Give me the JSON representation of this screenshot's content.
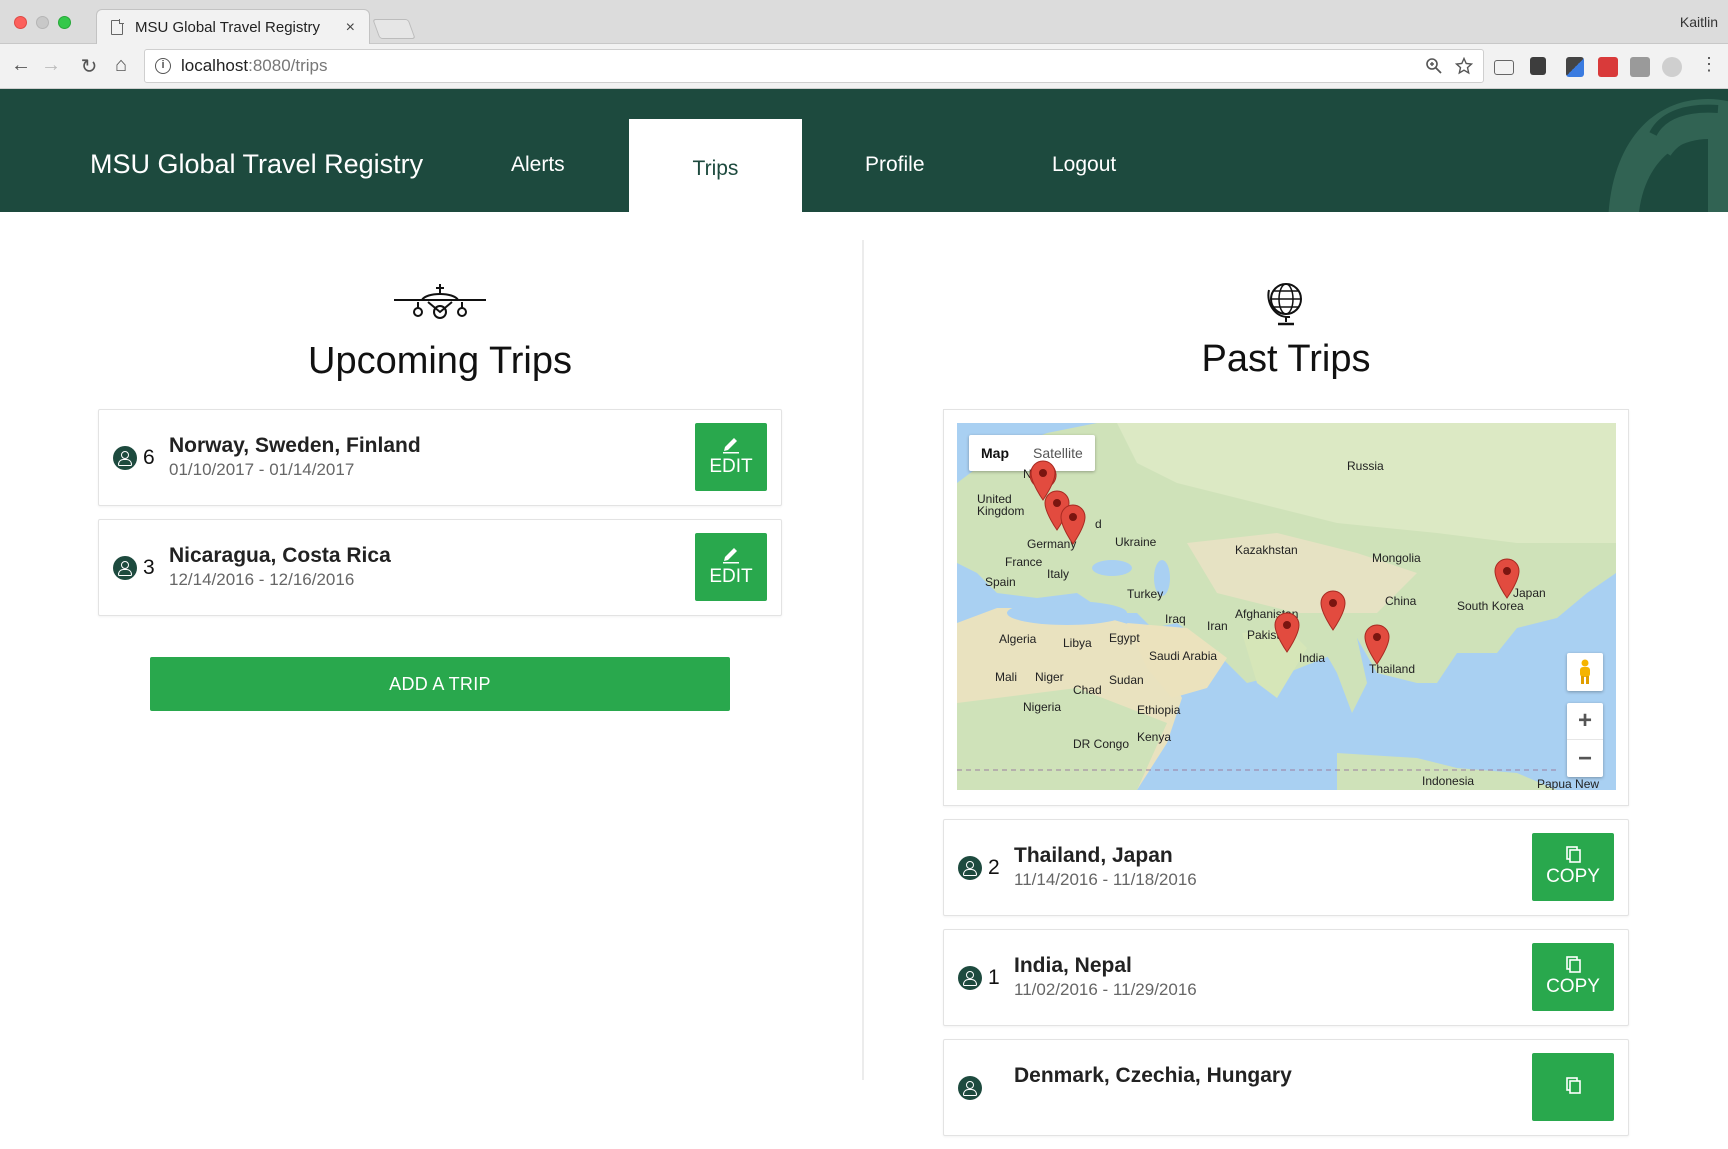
{
  "browser": {
    "tab_title": "MSU Global Travel Registry",
    "tab_close": "×",
    "user": "Kaitlin",
    "url_host": "localhost",
    "url_path": ":8080/trips",
    "back": "←",
    "forward": "→",
    "reload": "↻",
    "home": "⌂"
  },
  "header": {
    "brand": "MSU Global Travel Registry",
    "nav": {
      "alerts": "Alerts",
      "trips": "Trips",
      "profile": "Profile",
      "logout": "Logout"
    },
    "bg_color": "#1d4a3e"
  },
  "upcoming": {
    "title": "Upcoming Trips",
    "icon": "airplane-icon",
    "trips": [
      {
        "count": "6",
        "destinations": "Norway, Sweden, Finland",
        "dates": "01/10/2017 - 01/14/2017",
        "action": "EDIT"
      },
      {
        "count": "3",
        "destinations": "Nicaragua, Costa Rica",
        "dates": "12/14/2016 - 12/16/2016",
        "action": "EDIT"
      }
    ],
    "add_button": "ADD A TRIP"
  },
  "past": {
    "title": "Past Trips",
    "icon": "globe-icon",
    "map": {
      "type_map": "Map",
      "type_satellite": "Satellite",
      "zoom_in": "+",
      "zoom_out": "−",
      "labels": [
        "Russia",
        "United Kingdom",
        "Germany",
        "Ukraine",
        "Kazakhstan",
        "Mongolia",
        "France",
        "Spain",
        "Italy",
        "Turkey",
        "China",
        "South Korea",
        "Japan",
        "Afghanistan",
        "Iraq",
        "Iran",
        "Pakistan",
        "India",
        "Thailand",
        "Algeria",
        "Libya",
        "Egypt",
        "Saudi Arabia",
        "Mali",
        "Niger",
        "Chad",
        "Sudan",
        "Nigeria",
        "Ethiopia",
        "Kenya",
        "DR Congo",
        "Indonesia",
        "Papua New",
        "No",
        "d",
        "Finland"
      ]
    },
    "trips": [
      {
        "count": "2",
        "destinations": "Thailand, Japan",
        "dates": "11/14/2016 - 11/18/2016",
        "action": "COPY"
      },
      {
        "count": "1",
        "destinations": "India, Nepal",
        "dates": "11/02/2016 - 11/29/2016",
        "action": "COPY"
      },
      {
        "count": "",
        "destinations": "Denmark, Czechia, Hungary",
        "dates": "",
        "action": ""
      }
    ]
  },
  "colors": {
    "accent": "#29a84d",
    "brand": "#1d4a3e",
    "pin": "#e0473c"
  }
}
